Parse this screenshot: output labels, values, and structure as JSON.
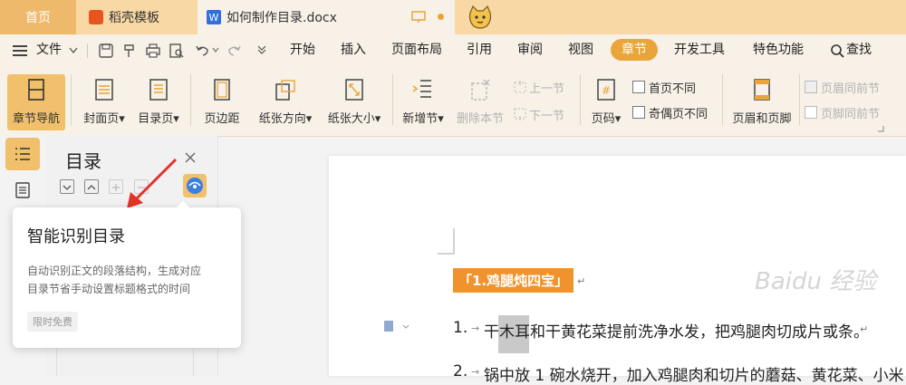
{
  "tabs": {
    "home": "首页",
    "template": "稻壳模板",
    "doc": "如何制作目录.docx",
    "doc_icon_letter": "W"
  },
  "menu": [
    "文件",
    "开始",
    "插入",
    "页面布局",
    "引用",
    "审阅",
    "视图",
    "章节",
    "开发工具",
    "特色功能"
  ],
  "search_label": "查找",
  "ribbon": {
    "chapter_nav": "章节导航",
    "cover_page": "封面页",
    "toc_page": "目录页",
    "margins": "页边距",
    "orientation": "纸张方向",
    "paper_size": "纸张大小",
    "new_section": "新增节",
    "delete_section": "删除本节",
    "prev_section": "上一节",
    "next_section": "下一节",
    "page_number": "页码",
    "first_page_diff": "首页不同",
    "odd_even_diff": "奇偶页不同",
    "header_footer": "页眉和页脚",
    "header_same": "页眉同前节",
    "footer_same": "页脚同前节"
  },
  "nav_panel": {
    "title": "目录"
  },
  "tooltip": {
    "title": "智能识别目录",
    "body_line1": "自动识别正文的段落结构，生成对应",
    "body_line2": "目录节省手动设置标题格式的时间",
    "badge": "限时免费"
  },
  "document": {
    "heading": "「1.鸡腿炖四宝」",
    "item1_num": "1.",
    "item1_text": "干木耳和干黄花菜提前洗净水发，把鸡腿肉切成片或条。",
    "item2_num": "2.",
    "item2_text": "锅中放 1 碗水烧开，加入鸡腿肉和切片的蘑菇、黄花菜、小米"
  },
  "watermark": "Baidu 经验",
  "colors": {
    "accent": "#e9a53a",
    "heading_bg": "#f0922e",
    "tab_bg": "#f8d8a4",
    "arrow": "#e0342a"
  }
}
